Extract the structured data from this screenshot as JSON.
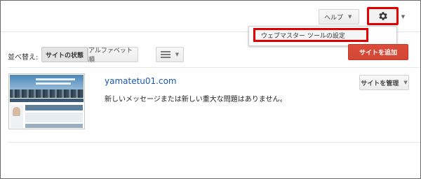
{
  "header": {
    "help_label": "ヘルプ",
    "settings_icon": "gear-icon"
  },
  "settings_menu": {
    "items": [
      "ウェブマスター ツールの設定"
    ]
  },
  "toolbar": {
    "sort_label": "並べ替え:",
    "sort_status_label": "サイトの状態",
    "sort_alpha_label": "アルファベット順",
    "view_icon": "list-view-icon",
    "add_site_label": "サイトを追加"
  },
  "sites": [
    {
      "name": "yamatetu01.com",
      "message": "新しいメッセージまたは新しい重大な問題はありません。",
      "manage_label": "サイトを管理"
    }
  ],
  "colors": {
    "highlight_border": "#e00000",
    "add_button": "#d14836",
    "link": "#1a57b5"
  }
}
